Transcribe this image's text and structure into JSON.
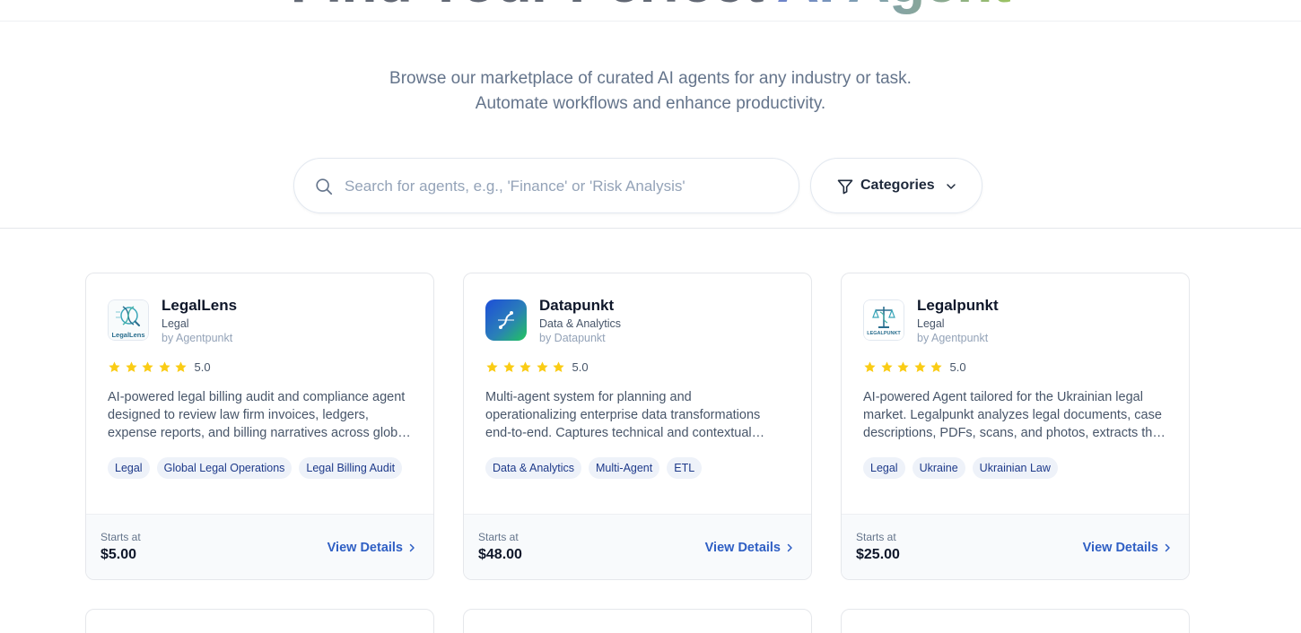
{
  "hero": {
    "title_plain": "Find Your Perfect ",
    "title_highlight": "AI Agent",
    "subtitle_line1": "Browse our marketplace of curated AI agents for any industry or task.",
    "subtitle_line2": "Automate workflows and enhance productivity."
  },
  "search": {
    "placeholder": "Search for agents, e.g., 'Finance' or 'Risk Analysis'",
    "value": ""
  },
  "categories": {
    "label": "Categories"
  },
  "cards": [
    {
      "name": "LegalLens",
      "category": "Legal",
      "by": "by Agentpunkt",
      "logo_text": "LegalLens",
      "rating_value": 5.0,
      "rating_label": "5.0",
      "desc_line1": "AI-powered legal billing audit and compliance agent",
      "desc_line2": "designed to review law firm invoices, ledgers,",
      "desc_line3": "expense reports, and billing narratives across glob…",
      "tags": [
        "Legal",
        "Global Legal Operations",
        "Legal Billing Audit"
      ],
      "starts_label": "Starts at",
      "price": "$5.00",
      "view_label": "View Details"
    },
    {
      "name": "Datapunkt",
      "category": "Data & Analytics",
      "by": "by Datapunkt",
      "rating_value": 5.0,
      "rating_label": "5.0",
      "desc_line1": "Multi-agent system for planning and",
      "desc_line2": "operationalizing enterprise data transformations",
      "desc_line3": "end-to-end. Captures technical and contextual…",
      "tags": [
        "Data & Analytics",
        "Multi-Agent",
        "ETL"
      ],
      "starts_label": "Starts at",
      "price": "$48.00",
      "view_label": "View Details"
    },
    {
      "name": "Legalpunkt",
      "category": "Legal",
      "by": "by Agentpunkt",
      "logo_text": "LEGALPUNKT",
      "rating_value": 5.0,
      "rating_label": "5.0",
      "desc_line1": "AI-powered Agent tailored for the Ukrainian legal",
      "desc_line2": "market. Legalpunkt analyzes legal documents, case",
      "desc_line3": "descriptions, PDFs, scans, and photos, extracts th…",
      "tags": [
        "Legal",
        "Ukraine",
        "Ukrainian Law"
      ],
      "starts_label": "Starts at",
      "price": "$25.00",
      "view_label": "View Details"
    }
  ],
  "colors": {
    "accent_link": "#2f5fc4",
    "star": "#facc15",
    "tag_bg": "#eef2f9",
    "tag_text": "#1e3a8a",
    "title_gradient_start": "#1e40af",
    "title_gradient_end": "#65a30d"
  },
  "icons": {
    "search": "search-icon",
    "filter": "filter-icon",
    "chevron_down": "chevron-down-icon",
    "chevron_right": "chevron-right-icon",
    "star": "star-icon"
  }
}
